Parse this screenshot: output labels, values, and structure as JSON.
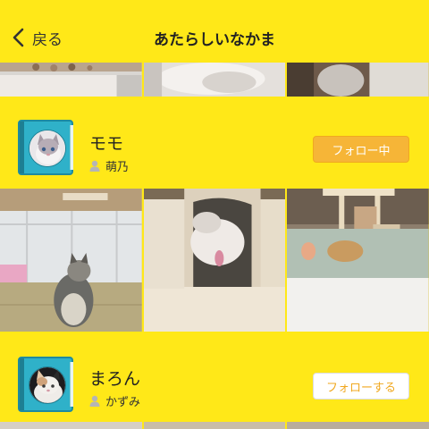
{
  "header": {
    "back_label": "戻る",
    "title": "あたらしいなかま"
  },
  "users": [
    {
      "name": "モモ",
      "owner": "萌乃",
      "follow_label": "フォロー中",
      "following": true
    },
    {
      "name": "まろん",
      "owner": "かずみ",
      "follow_label": "フォローする",
      "following": false
    }
  ],
  "colors": {
    "background": "#ffe818",
    "following_button": "#f6b537",
    "follow_button_text": "#f0a820",
    "book_icon": "#2fb1c9"
  },
  "icons": {
    "back": "chevron-left-icon",
    "owner": "person-icon"
  }
}
